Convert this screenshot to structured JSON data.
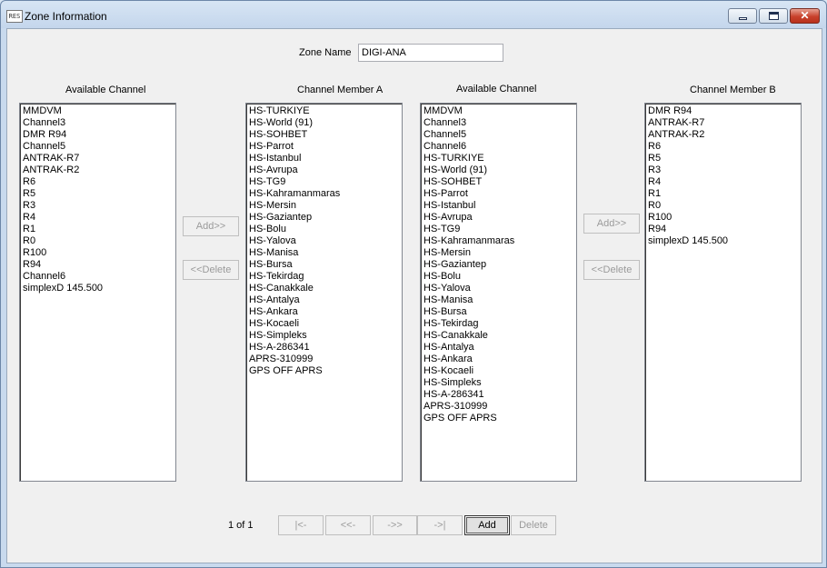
{
  "window": {
    "title": "Zone Information",
    "icon_text": "RES",
    "icon_name": "app-icon",
    "controls": {
      "minimize_icon": "minimize-icon",
      "maximize_icon": "maximize-icon",
      "close_icon": "close-icon",
      "close_glyph": "✕"
    }
  },
  "zone": {
    "label": "Zone Name",
    "value": "DIGI-ANA"
  },
  "panels": {
    "available_a": {
      "header": "Available Channel",
      "items": [
        "MMDVM",
        "Channel3",
        "DMR R94",
        "Channel5",
        "ANTRAK-R7",
        "ANTRAK-R2",
        "R6",
        "R5",
        "R3",
        "R4",
        "R1",
        "R0",
        "R100",
        "R94",
        "Channel6",
        "simplexD 145.500"
      ]
    },
    "member_a": {
      "header": "Channel Member A",
      "items": [
        "HS-TURKIYE",
        "HS-World (91)",
        "HS-SOHBET",
        "HS-Parrot",
        "HS-Istanbul",
        "HS-Avrupa",
        "HS-TG9",
        "HS-Kahramanmaras",
        "HS-Mersin",
        "HS-Gaziantep",
        "HS-Bolu",
        "HS-Yalova",
        "HS-Manisa",
        "HS-Bursa",
        "HS-Tekirdag",
        "HS-Canakkale",
        "HS-Antalya",
        "HS-Ankara",
        "HS-Kocaeli",
        "HS-Simpleks",
        "HS-A-286341",
        "APRS-310999",
        "GPS OFF APRS"
      ]
    },
    "available_b": {
      "header": "Available Channel",
      "items": [
        "MMDVM",
        "Channel3",
        "Channel5",
        "Channel6",
        "HS-TURKIYE",
        "HS-World (91)",
        "HS-SOHBET",
        "HS-Parrot",
        "HS-Istanbul",
        "HS-Avrupa",
        "HS-TG9",
        "HS-Kahramanmaras",
        "HS-Mersin",
        "HS-Gaziantep",
        "HS-Bolu",
        "HS-Yalova",
        "HS-Manisa",
        "HS-Bursa",
        "HS-Tekirdag",
        "HS-Canakkale",
        "HS-Antalya",
        "HS-Ankara",
        "HS-Kocaeli",
        "HS-Simpleks",
        "HS-A-286341",
        "APRS-310999",
        "GPS OFF APRS"
      ]
    },
    "member_b": {
      "header": "Channel Member B",
      "items": [
        "DMR R94",
        "ANTRAK-R7",
        "ANTRAK-R2",
        "R6",
        "R5",
        "R3",
        "R4",
        "R1",
        "R0",
        "R100",
        "R94",
        "simplexD 145.500"
      ]
    }
  },
  "transfer": {
    "add_label": "Add>>",
    "delete_label": "<<Delete"
  },
  "pager": {
    "text": "1 of 1",
    "first": "|<-",
    "prev": "<<-",
    "next": "->>",
    "last": "->|",
    "add": "Add",
    "delete": "Delete"
  }
}
